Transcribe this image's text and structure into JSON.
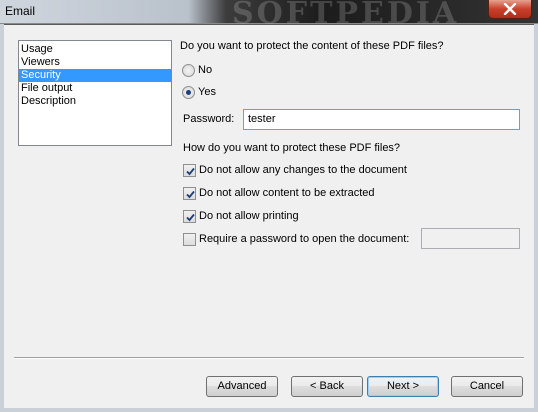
{
  "window": {
    "title": "Email",
    "watermark": "SOFTPEDIA"
  },
  "nav": {
    "items": [
      {
        "label": "Usage"
      },
      {
        "label": "Viewers"
      },
      {
        "label": "Security",
        "selected": true
      },
      {
        "label": "File output"
      },
      {
        "label": "Description"
      }
    ]
  },
  "security": {
    "question_protect": "Do you want to protect the content of these PDF files?",
    "option_no": "No",
    "option_yes": "Yes",
    "selected_option": "Yes",
    "password_label": "Password:",
    "password_value": "tester",
    "question_how": "How do you want to protect these PDF files?",
    "checks": [
      {
        "label": "Do not allow any changes to the document",
        "checked": true
      },
      {
        "label": "Do not allow content to be extracted",
        "checked": true
      },
      {
        "label": "Do not allow printing",
        "checked": true
      },
      {
        "label": "Require a password to open the document:",
        "checked": false
      }
    ],
    "open_password_value": ""
  },
  "buttons": {
    "advanced": "Advanced",
    "back": "< Back",
    "next": "Next >",
    "cancel": "Cancel"
  },
  "icons": {
    "close": "close-icon",
    "check": "checkmark-icon"
  }
}
